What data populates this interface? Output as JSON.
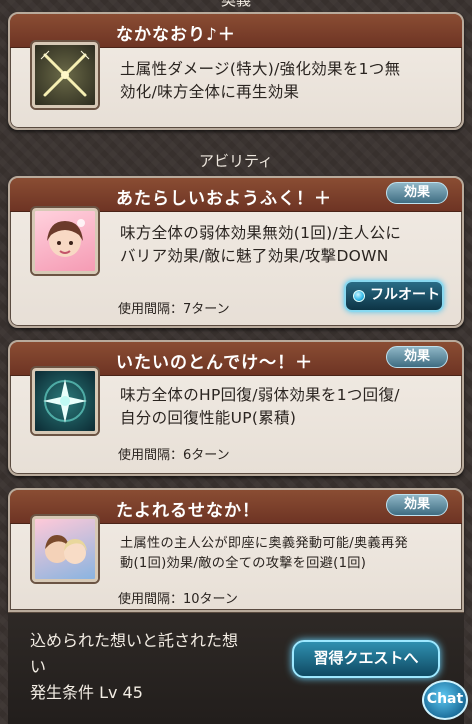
{
  "header_partial": "奥義",
  "ougi": {
    "name": "なかなおり♪＋",
    "description_lines": [
      "土属性ダメージ(特大)/強化効果を1つ無",
      "効化/味方全体に再生効果"
    ],
    "icon": "crossed-swords-icon"
  },
  "section_title": "アビリティ",
  "abilities": [
    {
      "name": "あたらしいおようふく！＋",
      "tag": "効果",
      "description_lines": [
        "味方全体の弱体効果無効(1回)/主人公に",
        "バリア効果/敵に魅了効果/攻撃DOWN"
      ],
      "cooldown": "使用間隔：7ターン",
      "icon": "character-portrait-icon"
    },
    {
      "name": "いたいのとんでけ〜！＋",
      "tag": "効果",
      "description_lines": [
        "味方全体のHP回復/弱体効果を1つ回復/",
        "自分の回復性能UP(累積)"
      ],
      "cooldown": "使用間隔：6ターン",
      "icon": "sparkle-heal-icon"
    },
    {
      "name": "たよれるせなか！",
      "tag": "効果",
      "description_lines": [
        "土属性の主人公が即座に奥義発動可能/奥義再発",
        "動(1回)効果/敵の全ての攻撃を回避(1回)"
      ],
      "cooldown": "使用間隔：10ターン",
      "icon": "duo-portrait-icon"
    }
  ],
  "fullauto_button": "フルオート",
  "quest": {
    "title_line1": "込められた想いと託された想",
    "title_line2": "い",
    "condition": "発生条件 Lv 45",
    "button": "習得クエストへ"
  },
  "chat_button": "Chat",
  "colors": {
    "header_bar": "#7a3f2a",
    "tag_blue": "#3f6d82",
    "button_glow": "#8ad9f0"
  }
}
